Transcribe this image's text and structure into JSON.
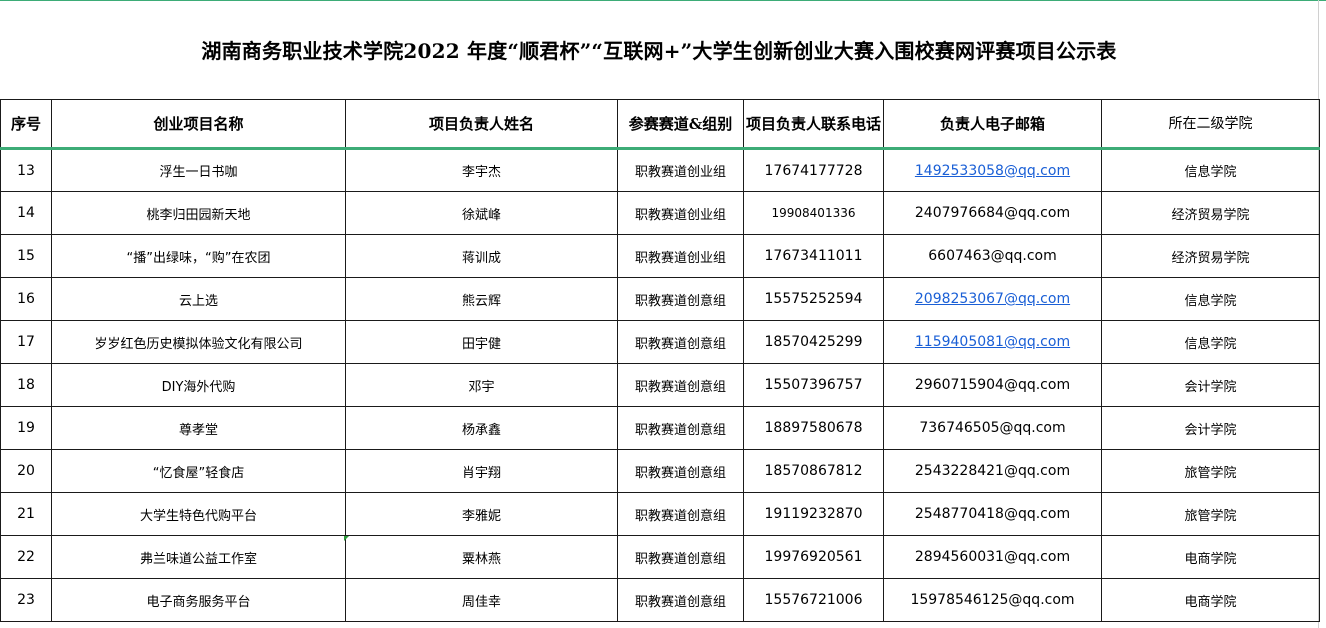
{
  "title": "湖南商务职业技术学院2022 年度“顺君杯”“互联网+”大学生创新创业大赛入围校赛网评赛项目公示表",
  "colors": {
    "accent_rule": "#3dac77",
    "link": "#1a5fd6",
    "border": "#1a1a1a"
  },
  "headers": {
    "no": "序号",
    "name": "创业项目名称",
    "person": "项目负责人姓名",
    "track": "参赛赛道&组别",
    "phone": "项目负责人联系电话",
    "email": "负责人电子邮箱",
    "college": "所在二级学院"
  },
  "rows": [
    {
      "no": "13",
      "name": "浮生一日书咖",
      "person": "李宇杰",
      "track": "职教赛道创业组",
      "phone": "17674177728",
      "email": "1492533058@qq.com",
      "email_linked": true,
      "college": "信息学院"
    },
    {
      "no": "14",
      "name": "桃李归田园新天地",
      "person": "徐斌峰",
      "track": "职教赛道创业组",
      "phone": "19908401336",
      "email": "2407976684@qq.com",
      "email_linked": false,
      "college": "经济贸易学院"
    },
    {
      "no": "15",
      "name": "“播”出绿味，“购”在农团",
      "person": "蒋训成",
      "track": "职教赛道创业组",
      "phone": "17673411011",
      "email": "6607463@qq.com",
      "email_linked": false,
      "college": "经济贸易学院"
    },
    {
      "no": "16",
      "name": "云上选",
      "person": "熊云辉",
      "track": "职教赛道创意组",
      "phone": "15575252594",
      "email": "2098253067@qq.com",
      "email_linked": true,
      "college": "信息学院"
    },
    {
      "no": "17",
      "name": "岁岁红色历史模拟体验文化有限公司",
      "person": "田宇健",
      "track": "职教赛道创意组",
      "phone": "18570425299",
      "email": "1159405081@qq.com",
      "email_linked": true,
      "college": "信息学院"
    },
    {
      "no": "18",
      "name": "DIY海外代购",
      "person": "邓宇",
      "track": "职教赛道创意组",
      "phone": "15507396757",
      "email": "2960715904@qq.com",
      "email_linked": false,
      "college": "会计学院"
    },
    {
      "no": "19",
      "name": "尊孝堂",
      "person": "杨承鑫",
      "track": "职教赛道创意组",
      "phone": "18897580678",
      "email": "736746505@qq.com",
      "email_linked": false,
      "college": "会计学院"
    },
    {
      "no": "20",
      "name": "“忆食屋”轻食店",
      "person": "肖宇翔",
      "track": "职教赛道创意组",
      "phone": "18570867812",
      "email": "2543228421@qq.com",
      "email_linked": false,
      "college": "旅管学院"
    },
    {
      "no": "21",
      "name": "大学生特色代购平台",
      "person": "李雅妮",
      "track": "职教赛道创意组",
      "phone": "19119232870",
      "email": "2548770418@qq.com",
      "email_linked": false,
      "college": "旅管学院"
    },
    {
      "no": "22",
      "name": "弗兰味道公益工作室",
      "person": "粟林燕",
      "track": "职教赛道创意组",
      "phone": "19976920561",
      "email": "2894560031@qq.com",
      "email_linked": false,
      "college": "电商学院"
    },
    {
      "no": "23",
      "name": "电子商务服务平台",
      "person": "周佳幸",
      "track": "职教赛道创意组",
      "phone": "15576721006",
      "email": "15978546125@qq.com",
      "email_linked": false,
      "college": "电商学院"
    }
  ]
}
